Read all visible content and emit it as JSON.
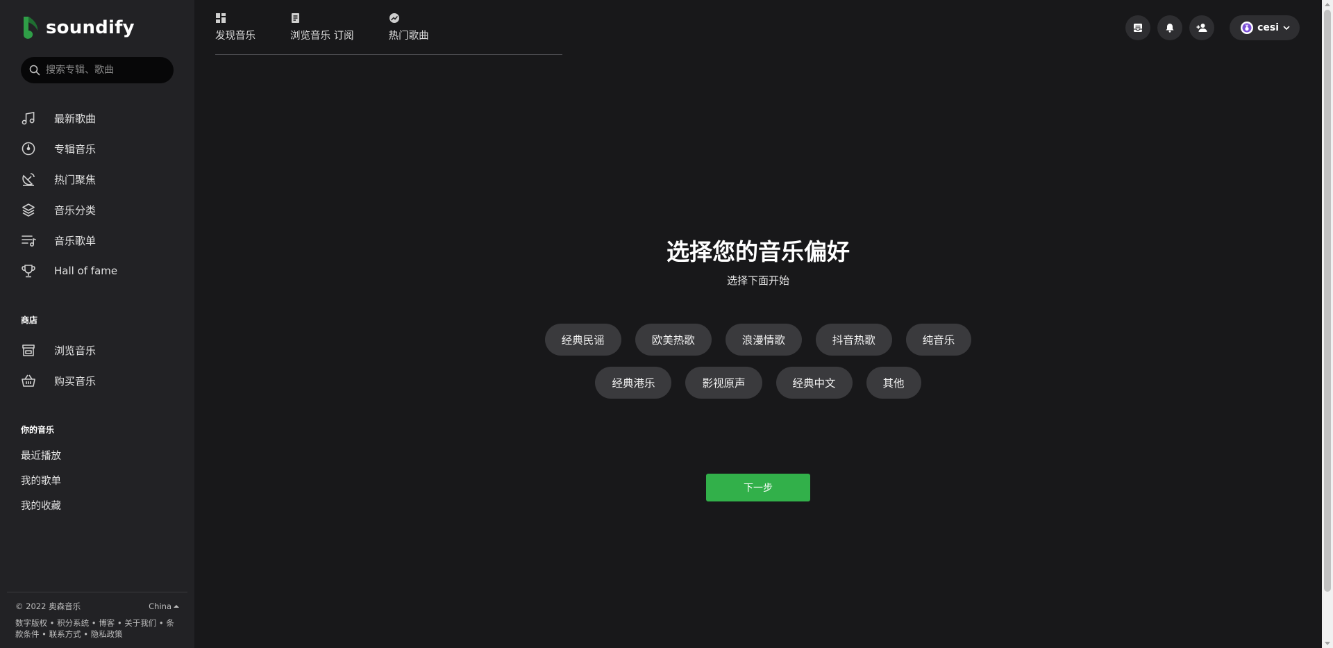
{
  "brand": {
    "name": "soundify",
    "accent": "#32b04a"
  },
  "search": {
    "placeholder": "搜索专辑、歌曲",
    "value": ""
  },
  "sidebar": {
    "main_items": [
      {
        "label": "最新歌曲",
        "icon": "music-note-icon"
      },
      {
        "label": "专辑音乐",
        "icon": "disc-icon"
      },
      {
        "label": "热门聚焦",
        "icon": "satellite-dish-icon"
      },
      {
        "label": "音乐分类",
        "icon": "layers-icon"
      },
      {
        "label": "音乐歌单",
        "icon": "playlist-icon"
      },
      {
        "label": "Hall of fame",
        "icon": "trophy-icon"
      }
    ],
    "shop_title": "商店",
    "shop_items": [
      {
        "label": "浏览音乐",
        "icon": "store-icon"
      },
      {
        "label": "购买音乐",
        "icon": "basket-icon"
      }
    ],
    "yours_title": "你的音乐",
    "yours_items": [
      "最近播放",
      "我的歌单",
      "我的收藏"
    ]
  },
  "footer": {
    "copyright": "© 2022 奥森音乐",
    "region": "China",
    "links": "数字版权 • 积分系统 • 博客 • 关于我们 • 条款条件 • 联系方式 • 隐私政策"
  },
  "tabs": [
    {
      "label": "发现音乐",
      "icon": "dashboard-icon"
    },
    {
      "label": "浏览音乐  订阅",
      "icon": "document-icon"
    },
    {
      "label": "热门歌曲",
      "icon": "trending-icon"
    }
  ],
  "header": {
    "user_name": "cesi",
    "actions": [
      "inbox-icon",
      "bell-icon",
      "add-user-icon"
    ]
  },
  "main": {
    "title": "选择您的音乐偏好",
    "subtitle": "选择下面开始",
    "genres": [
      "经典民谣",
      "欧美热歌",
      "浪漫情歌",
      "抖音热歌",
      "纯音乐",
      "经典港乐",
      "影视原声",
      "经典中文",
      "其他"
    ],
    "next_label": "下一步"
  }
}
